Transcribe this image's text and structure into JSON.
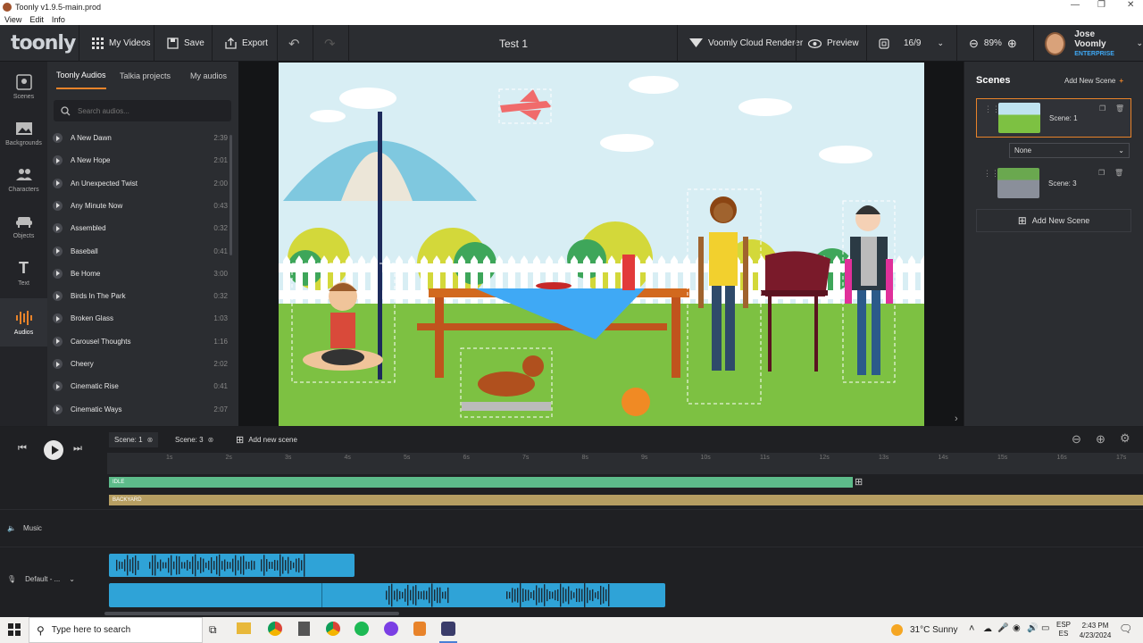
{
  "window": {
    "title": "Toonly v1.9.5-main.prod",
    "menu": [
      "View",
      "Edit",
      "Info"
    ]
  },
  "toolbar": {
    "logo": "toonly",
    "my_videos": "My Videos",
    "save": "Save",
    "export": "Export",
    "project_title": "Test 1",
    "cloud_renderer": "Voomly Cloud Renderer",
    "preview": "Preview",
    "aspect_ratio": "16/9",
    "zoom": "89%",
    "user_name": "Jose Voomly",
    "user_plan": "ENTERPRISE"
  },
  "leftnav": [
    "Scenes",
    "Backgrounds",
    "Characters",
    "Objects",
    "Text",
    "Audios"
  ],
  "audio_panel": {
    "tabs": [
      "Toonly Audios",
      "Talkia projects",
      "My audios"
    ],
    "search_placeholder": "Search audios...",
    "items": [
      {
        "name": "A New Dawn",
        "dur": "2:39"
      },
      {
        "name": "A New Hope",
        "dur": "2:01"
      },
      {
        "name": "An Unexpected Twist",
        "dur": "2:00"
      },
      {
        "name": "Any Minute Now",
        "dur": "0:43"
      },
      {
        "name": "Assembled",
        "dur": "0:32"
      },
      {
        "name": "Baseball",
        "dur": "0:41"
      },
      {
        "name": "Be Home",
        "dur": "3:00"
      },
      {
        "name": "Birds In The Park",
        "dur": "0:32"
      },
      {
        "name": "Broken Glass",
        "dur": "1:03"
      },
      {
        "name": "Carousel Thoughts",
        "dur": "1:16"
      },
      {
        "name": "Cheery",
        "dur": "2:02"
      },
      {
        "name": "Cinematic Rise",
        "dur": "0:41"
      },
      {
        "name": "Cinematic Ways",
        "dur": "2:07"
      }
    ]
  },
  "scenes_panel": {
    "title": "Scenes",
    "add_label": "Add New Scene",
    "scene1": "Scene: 1",
    "transition": "None",
    "scene3": "Scene: 3",
    "add_button": "Add New Scene"
  },
  "timeline": {
    "tab1": "Scene: 1",
    "tab2": "Scene: 3",
    "add_scene": "Add new scene",
    "ticks": [
      "1s",
      "2s",
      "3s",
      "4s",
      "5s",
      "6s",
      "7s",
      "8s",
      "9s",
      "10s",
      "11s",
      "12s",
      "13s",
      "14s",
      "15s",
      "16s",
      "17s"
    ],
    "idle": "IDLE",
    "backyard": "BACKYARD",
    "music": "Music",
    "mic": "Default - ..."
  },
  "taskbar": {
    "search_placeholder": "Type here to search",
    "weather": "31°C  Sunny",
    "lang1": "ESP",
    "lang2": "ES",
    "time": "2:43 PM",
    "date": "4/23/2024"
  },
  "colors": {
    "accent": "#e8832a",
    "idle_track": "#5dbb8a",
    "backyard_track": "#b69e62",
    "audio_clip": "#2fa3d7"
  }
}
